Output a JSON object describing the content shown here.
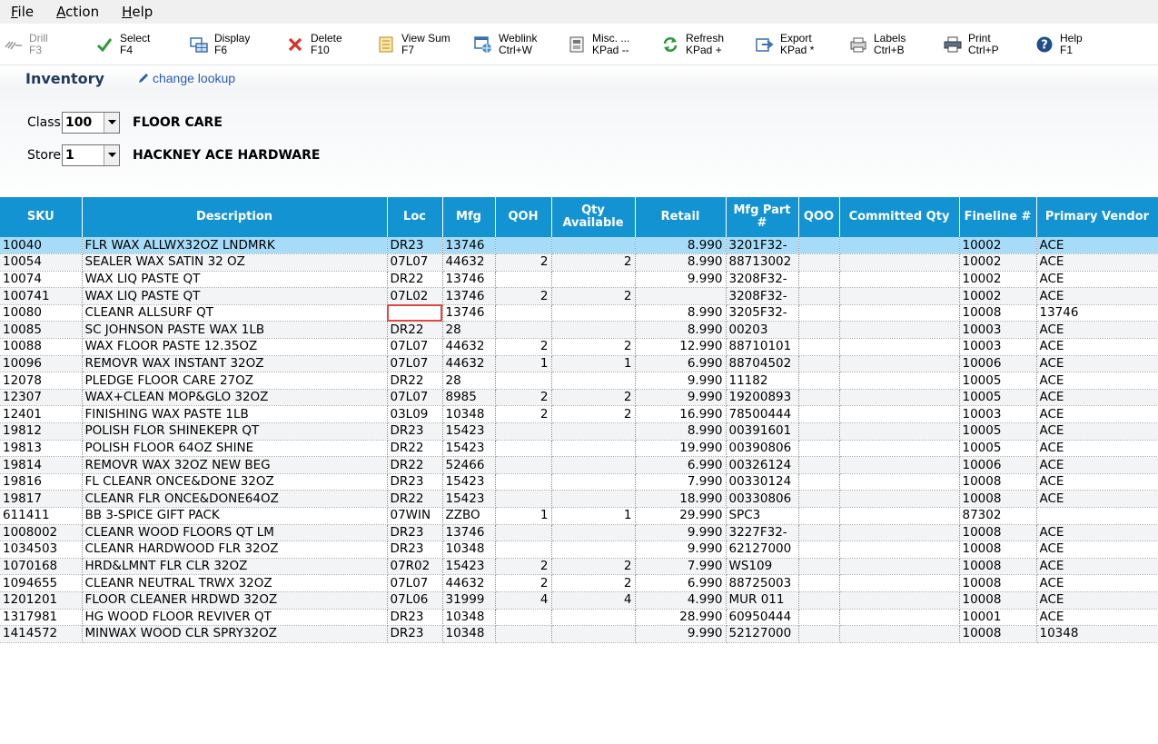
{
  "menu": [
    {
      "label": "File",
      "key": "F",
      "rest": "ile"
    },
    {
      "label": "Action",
      "key": "A",
      "rest": "ction"
    },
    {
      "label": "Help",
      "key": "H",
      "rest": "elp"
    }
  ],
  "toolbar": [
    {
      "name": "drill",
      "line1": "Drill",
      "line2": "F3",
      "icon": "drill-icon",
      "disabled": true
    },
    {
      "name": "select",
      "line1": "Select",
      "line2": "F4",
      "icon": "check-icon"
    },
    {
      "name": "display",
      "line1": "Display",
      "line2": "F6",
      "icon": "display-icon"
    },
    {
      "name": "delete",
      "line1": "Delete",
      "line2": "F10",
      "icon": "delete-icon"
    },
    {
      "name": "view-sum",
      "line1": "View Sum",
      "line2": "F7",
      "icon": "sum-icon"
    },
    {
      "name": "weblink",
      "line1": "Weblink",
      "line2": "Ctrl+W",
      "icon": "weblink-icon"
    },
    {
      "name": "misc",
      "line1": "Misc. ...",
      "line2": "KPad --",
      "icon": "misc-icon"
    },
    {
      "name": "refresh",
      "line1": "Refresh",
      "line2": "KPad +",
      "icon": "refresh-icon"
    },
    {
      "name": "export",
      "line1": "Export",
      "line2": "KPad *",
      "icon": "export-icon"
    },
    {
      "name": "labels",
      "line1": "Labels",
      "line2": "Ctrl+B",
      "icon": "labels-icon"
    },
    {
      "name": "print",
      "line1": "Print",
      "line2": "Ctrl+P",
      "icon": "print-icon"
    },
    {
      "name": "help",
      "line1": "Help",
      "line2": "F1",
      "icon": "help-icon"
    }
  ],
  "header": {
    "title": "Inventory",
    "change_lookup": "change lookup"
  },
  "filters": {
    "class": {
      "label": "Class",
      "value": "100",
      "desc": "FLOOR CARE"
    },
    "store": {
      "label": "Store",
      "value": "1",
      "desc": "HACKNEY ACE HARDWARE"
    }
  },
  "columns": [
    "SKU",
    "Description",
    "Loc",
    "Mfg",
    "QOH",
    "Qty Available",
    "Retail",
    "Mfg Part #",
    "QOO",
    "Committed Qty",
    "Fineline #",
    "Primary Vendor"
  ],
  "rows": [
    [
      "10040",
      "FLR WAX ALLWX32OZ LNDMRK",
      "DR23",
      "13746",
      "",
      "",
      "8.990",
      "3201F32-",
      "",
      "",
      "10002",
      "ACE"
    ],
    [
      "10054",
      "SEALER WAX SATIN 32 OZ",
      "07L07",
      "44632",
      "2",
      "2",
      "8.990",
      "88713002",
      "",
      "",
      "10002",
      "ACE"
    ],
    [
      "10074",
      "WAX LIQ PASTE QT",
      "DR22",
      "13746",
      "",
      "",
      "9.990",
      "3208F32-",
      "",
      "",
      "10002",
      "ACE"
    ],
    [
      "100741",
      "WAX LIQ PASTE QT",
      "07L02",
      "13746",
      "2",
      "2",
      "",
      "3208F32-",
      "",
      "",
      "10002",
      "ACE"
    ],
    [
      "10080",
      "CLEANR ALLSURF QT",
      "",
      "13746",
      "",
      "",
      "8.990",
      "3205F32-",
      "",
      "",
      "10008",
      "13746"
    ],
    [
      "10085",
      "SC JOHNSON PASTE WAX 1LB",
      "DR22",
      "28",
      "",
      "",
      "8.990",
      "00203",
      "",
      "",
      "10003",
      "ACE"
    ],
    [
      "10088",
      "WAX FLOOR PASTE 12.35OZ",
      "07L07",
      "44632",
      "2",
      "2",
      "12.990",
      "88710101",
      "",
      "",
      "10003",
      "ACE"
    ],
    [
      "10096",
      "REMOVR WAX INSTANT 32OZ",
      "07L07",
      "44632",
      "1",
      "1",
      "6.990",
      "88704502",
      "",
      "",
      "10006",
      "ACE"
    ],
    [
      "12078",
      "PLEDGE FLOOR CARE 27OZ",
      "DR22",
      "28",
      "",
      "",
      "9.990",
      "11182",
      "",
      "",
      "10005",
      "ACE"
    ],
    [
      "12307",
      "WAX+CLEAN MOP&GLO 32OZ",
      "07L07",
      "8985",
      "2",
      "2",
      "9.990",
      "19200893",
      "",
      "",
      "10005",
      "ACE"
    ],
    [
      "12401",
      "FINISHING WAX PASTE 1LB",
      "03L09",
      "10348",
      "2",
      "2",
      "16.990",
      "78500444",
      "",
      "",
      "10003",
      "ACE"
    ],
    [
      "19812",
      "POLISH FLOR SHINEKEPR QT",
      "DR23",
      "15423",
      "",
      "",
      "8.990",
      "00391601",
      "",
      "",
      "10005",
      "ACE"
    ],
    [
      "19813",
      "POLISH FLOOR 64OZ SHINE",
      "DR22",
      "15423",
      "",
      "",
      "19.990",
      "00390806",
      "",
      "",
      "10005",
      "ACE"
    ],
    [
      "19814",
      "REMOVR WAX 32OZ NEW BEG",
      "DR22",
      "52466",
      "",
      "",
      "6.990",
      "00326124",
      "",
      "",
      "10006",
      "ACE"
    ],
    [
      "19816",
      "FL CLEANR ONCE&DONE 32OZ",
      "DR23",
      "15423",
      "",
      "",
      "7.990",
      "00330124",
      "",
      "",
      "10008",
      "ACE"
    ],
    [
      "19817",
      "CLEANR FLR ONCE&DONE64OZ",
      "DR22",
      "15423",
      "",
      "",
      "18.990",
      "00330806",
      "",
      "",
      "10008",
      "ACE"
    ],
    [
      "611411",
      "BB 3-SPICE GIFT PACK",
      "07WIN",
      "ZZBO",
      "1",
      "1",
      "29.990",
      "SPC3",
      "",
      "",
      "87302",
      ""
    ],
    [
      "1008002",
      "CLEANR WOOD FLOORS QT LM",
      "DR23",
      "13746",
      "",
      "",
      "9.990",
      "3227F32-",
      "",
      "",
      "10008",
      "ACE"
    ],
    [
      "1034503",
      "CLEANR HARDWOOD FLR 32OZ",
      "DR23",
      "10348",
      "",
      "",
      "9.990",
      "62127000",
      "",
      "",
      "10008",
      "ACE"
    ],
    [
      "1070168",
      "HRD&LMNT FLR CLR 32OZ",
      "07R02",
      "15423",
      "2",
      "2",
      "7.990",
      "WS109",
      "",
      "",
      "10008",
      "ACE"
    ],
    [
      "1094655",
      "CLEANR NEUTRAL TRWX 32OZ",
      "07L07",
      "44632",
      "2",
      "2",
      "6.990",
      "88725003",
      "",
      "",
      "10008",
      "ACE"
    ],
    [
      "1201201",
      "FLOOR CLEANER HRDWD 32OZ",
      "07L06",
      "31999",
      "4",
      "4",
      "4.990",
      "MUR 011",
      "",
      "",
      "10008",
      "ACE"
    ],
    [
      "1317981",
      "HG WOOD FLOOR REVIVER QT",
      "DR23",
      "10348",
      "",
      "",
      "28.990",
      "60950444",
      "",
      "",
      "10001",
      "ACE"
    ],
    [
      "1414572",
      "MINWAX WOOD CLR SPRY32OZ",
      "DR23",
      "10348",
      "",
      "",
      "9.990",
      "52127000",
      "",
      "",
      "10008",
      "10348"
    ]
  ],
  "selected_row": 0,
  "focus_cell": {
    "row": 4,
    "col": 2
  },
  "colors": {
    "header_bg": "#1493d3",
    "selected_row": "#a6dcf8",
    "focus_outline": "#e04848"
  }
}
